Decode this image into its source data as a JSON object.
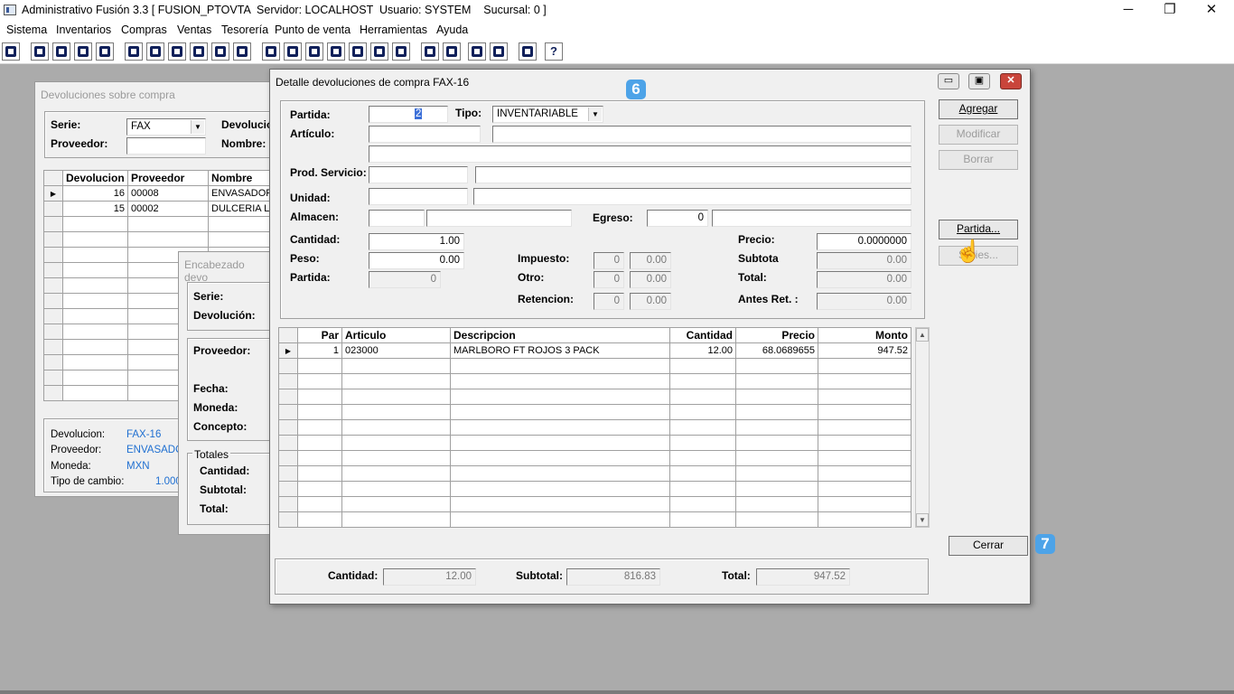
{
  "app": {
    "title": "Administrativo Fusión 3.3 [ FUSION_PTOVTA  Servidor: LOCALHOST  Usuario: SYSTEM    Sucursal: 0 ]",
    "window_controls": {
      "minimize": "─",
      "restore": "❐",
      "close": "✕"
    }
  },
  "menu": [
    "Sistema",
    "Inventarios",
    "Compras",
    "Ventas",
    "Tesorería",
    "Punto de venta",
    "Herramientas",
    "Ayuda"
  ],
  "toolbar_icons": [
    "calculator-icon",
    "copy-icon",
    "paste-icon",
    "transfer-icon",
    "find-icon",
    "user-icon",
    "folder-icon",
    "print-icon",
    "printer-icon",
    "document-icon",
    "list-icon",
    "people-icon",
    "open-folder-icon",
    "export-icon",
    "add-icon",
    "money-icon",
    "report-icon",
    "table-icon",
    "home-icon",
    "search-icon",
    "refresh-icon",
    "undo-icon",
    "back-icon",
    "help-icon"
  ],
  "toolbar_help_label": "?",
  "devoluciones_window": {
    "title": "Devoluciones sobre compra",
    "serie_label": "Serie:",
    "serie_value": "FAX",
    "devolucion_label": "Devolució",
    "proveedor_label": "Proveedor:",
    "nombre_label": "Nombre:",
    "columns": [
      "Devolucion",
      "Proveedor",
      "Nombre"
    ],
    "rows": [
      {
        "devolucion": "16",
        "proveedor": "00008",
        "nombre": "ENVASADORA"
      },
      {
        "devolucion": "15",
        "proveedor": "00002",
        "nombre": "DULCERIA LA"
      }
    ],
    "summary": {
      "devolucion_label": "Devolucion:",
      "devolucion_value": "FAX-16",
      "proveedor_label": "Proveedor:",
      "proveedor_value": "ENVASADOR",
      "moneda_label": "Moneda:",
      "moneda_value": "MXN",
      "tipo_cambio_label": "Tipo de cambio:",
      "tipo_cambio_value": "1.000"
    }
  },
  "encabezado_window": {
    "title": "Encabezado devo",
    "serie_label": "Serie:",
    "devolucion_label": "Devolución:",
    "proveedor_label": "Proveedor:",
    "fecha_label": "Fecha:",
    "moneda_label": "Moneda:",
    "concepto_label": "Concepto:",
    "totales_label": "Totales",
    "cantidad_label": "Cantidad:",
    "subtotal_label": "Subtotal:",
    "total_label": "Total:"
  },
  "detalle_window": {
    "title": "Detalle devoluciones de compra FAX-16",
    "caption_buttons": {
      "minimize": "▭",
      "maximize": "▣",
      "close": "✕"
    },
    "form": {
      "partida_label": "Partida:",
      "partida_value": "2",
      "tipo_label": "Tipo:",
      "tipo_value": "INVENTARIABLE",
      "articulo_label": "Artículo:",
      "prod_servicio_label": "Prod. Servicio:",
      "unidad_label": "Unidad:",
      "almacen_label": "Almacen:",
      "egreso_label": "Egreso:",
      "egreso_value": "0",
      "cantidad_label": "Cantidad:",
      "cantidad_value": "1.00",
      "peso_label": "Peso:",
      "peso_value": "0.00",
      "partida2_label": "Partida:",
      "partida2_value": "0",
      "impuesto_label": "Impuesto:",
      "impuesto_pct": "0",
      "impuesto_value": "0.00",
      "otro_label": "Otro:",
      "otro_pct": "0",
      "otro_value": "0.00",
      "retencion_label": "Retencion:",
      "retencion_pct": "0",
      "retencion_value": "0.00",
      "precio_label": "Precio:",
      "precio_value": "0.0000000",
      "subtotal_label": "Subtota",
      "subtotal_value": "0.00",
      "total_label": "Total:",
      "total_value": "0.00",
      "antes_ret_label": "Antes Ret. :",
      "antes_ret_value": "0.00"
    },
    "buttons": {
      "agregar": "Agregar",
      "modificar": "Modificar",
      "borrar": "Borrar",
      "partida": "Partida...",
      "series": "Series...",
      "cerrar": "Cerrar"
    },
    "grid": {
      "columns": [
        "Par",
        "Articulo",
        "Descripcion",
        "Cantidad",
        "Precio",
        "Monto"
      ],
      "rows": [
        {
          "par": "1",
          "articulo": "023000",
          "descripcion": "MARLBORO FT ROJOS 3 PACK",
          "cantidad": "12.00",
          "precio": "68.0689655",
          "monto": "947.52"
        }
      ],
      "empty_rows": 11
    },
    "totals": {
      "cantidad_label": "Cantidad:",
      "cantidad_value": "12.00",
      "subtotal_label": "Subtotal:",
      "subtotal_value": "816.83",
      "total_label": "Total:",
      "total_value": "947.52"
    }
  },
  "step_badges": {
    "six": "6",
    "seven": "7"
  },
  "colors": {
    "link_blue": "#1f6fd1",
    "badge": "#4da3e8",
    "close_red": "#c9453b"
  }
}
